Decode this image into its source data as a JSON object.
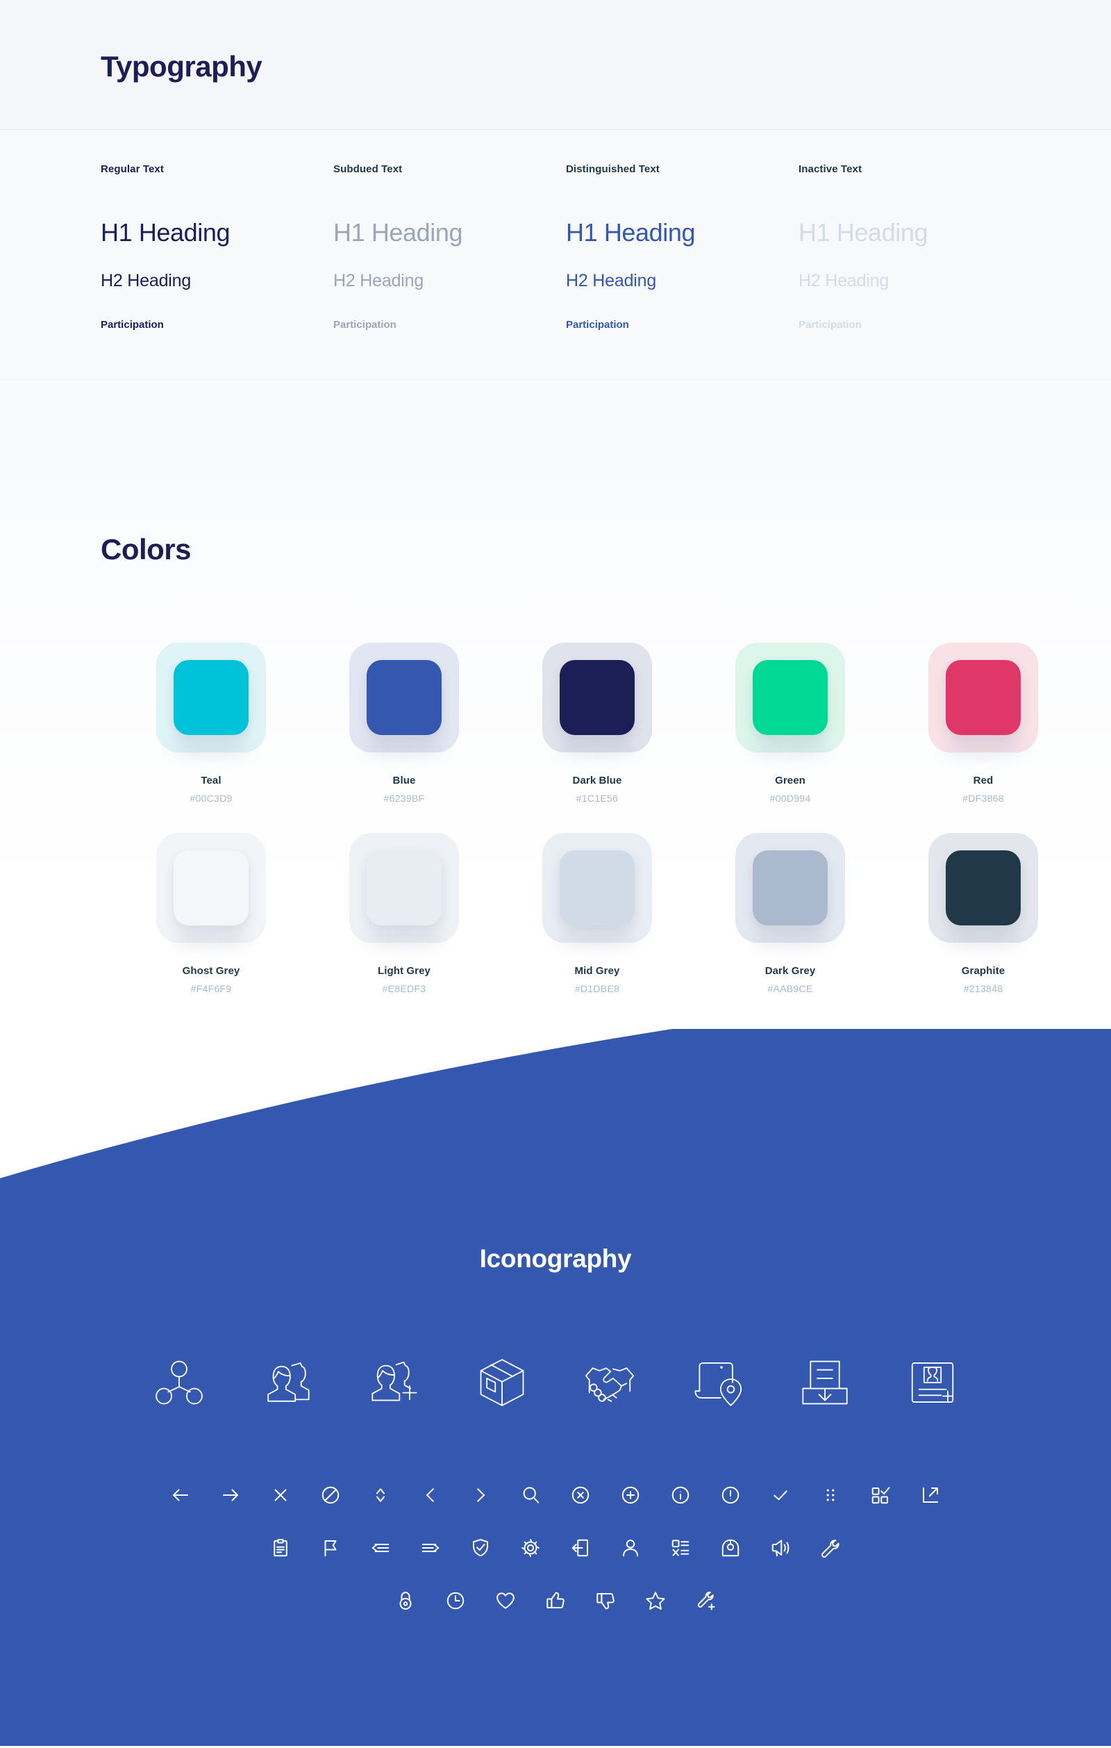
{
  "typography": {
    "title": "Typography",
    "columns": [
      {
        "label": "Regular Text",
        "h1": "H1 Heading",
        "h2": "H2 Heading",
        "body": "Participation",
        "color": "#1C1E56"
      },
      {
        "label": "Subdued Text",
        "h1": "H1 Heading",
        "h2": "H2 Heading",
        "body": "Participation",
        "color": "#9AA7B8"
      },
      {
        "label": "Distinguished Text",
        "h1": "H1 Heading",
        "h2": "H2 Heading",
        "body": "Participation",
        "color": "#3458B0"
      },
      {
        "label": "Inactive Text",
        "h1": "H1 Heading",
        "h2": "H2 Heading",
        "body": "Participation",
        "color": "#D4DCE8"
      }
    ]
  },
  "colors": {
    "title": "Colors",
    "swatches": [
      {
        "name": "Teal",
        "hex": "#00C3D9",
        "swatch": "#00C3D9",
        "tint": "#dff4f7"
      },
      {
        "name": "Blue",
        "hex": "#6239BF",
        "swatch": "#3458B0",
        "tint": "#e2e6f2"
      },
      {
        "name": "Dark Blue",
        "hex": "#1C1E56",
        "swatch": "#1C1E56",
        "tint": "#e0e2ec"
      },
      {
        "name": "Green",
        "hex": "#00D994",
        "swatch": "#00D994",
        "tint": "#ddf6ec"
      },
      {
        "name": "Red",
        "hex": "#DF3868",
        "swatch": "#DF3868",
        "tint": "#f8e2e8"
      },
      {
        "name": "Ghost Grey",
        "hex": "#F4F6F9",
        "swatch": "#F4F6F9",
        "tint": "#f2f4f8"
      },
      {
        "name": "Light Grey",
        "hex": "#E8EDF3",
        "swatch": "#E8EDF3",
        "tint": "#eef1f6"
      },
      {
        "name": "Mid Grey",
        "hex": "#D1DBE8",
        "swatch": "#D1DBE8",
        "tint": "#e9edf4"
      },
      {
        "name": "Dark Grey",
        "hex": "#AAB9CE",
        "swatch": "#AAB9CE",
        "tint": "#e4e9f1"
      },
      {
        "name": "Graphite",
        "hex": "#213848",
        "swatch": "#213848",
        "tint": "#e3e7ed"
      }
    ]
  },
  "iconography": {
    "title": "Iconography",
    "background": "#3458B0",
    "icon_color": "#FFFFFF",
    "large_icons": [
      "network-share-icon",
      "users-group-icon",
      "add-user-icon",
      "package-box-icon",
      "handshake-icon",
      "laptop-location-icon",
      "inbox-download-icon",
      "profile-card-add-icon"
    ],
    "small_rows": [
      [
        "arrow-left-icon",
        "arrow-right-icon",
        "close-icon",
        "block-icon",
        "sort-icon",
        "chevron-left-icon",
        "chevron-right-icon",
        "search-icon",
        "circle-close-icon",
        "circle-plus-icon",
        "info-icon",
        "alert-icon",
        "check-icon",
        "grid-dots-icon",
        "multi-select-icon",
        "external-link-icon"
      ],
      [
        "clipboard-icon",
        "flag-icon",
        "arrow-in-left-icon",
        "arrow-out-right-icon",
        "check-shield-icon",
        "gear-icon",
        "logout-icon",
        "user-icon",
        "task-list-icon",
        "gauge-icon",
        "megaphone-icon",
        "wrench-icon"
      ],
      [
        "lock-icon",
        "clock-icon",
        "heart-icon",
        "thumbs-up-icon",
        "thumbs-down-icon",
        "star-icon",
        "wrench-plus-icon"
      ]
    ]
  }
}
